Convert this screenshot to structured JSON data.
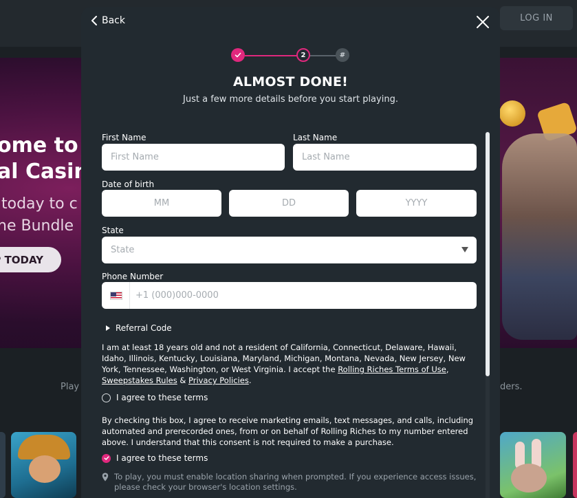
{
  "background": {
    "login_label": "LOG IN",
    "hero_line1": "ome to t",
    "hero_line2": "al Casino",
    "hero_line3": "today to c",
    "hero_line4": "ne Bundle",
    "hero_cta": "P TODAY",
    "sub_left": "Play",
    "sub_right": "ders."
  },
  "modal": {
    "back_label": "Back",
    "steps": [
      {
        "state": "done",
        "label": ""
      },
      {
        "state": "current",
        "label": "2"
      },
      {
        "state": "upcoming",
        "label": "#"
      }
    ],
    "title": "ALMOST DONE!",
    "subtitle": "Just a few more details before you start playing.",
    "form": {
      "first_name": {
        "label": "First Name",
        "placeholder": "First Name",
        "value": ""
      },
      "last_name": {
        "label": "Last Name",
        "placeholder": "Last Name",
        "value": ""
      },
      "dob": {
        "label": "Date of birth",
        "month_placeholder": "MM",
        "day_placeholder": "DD",
        "year_placeholder": "YYYY"
      },
      "state": {
        "label": "State",
        "selected": "State"
      },
      "phone": {
        "label": "Phone Number",
        "placeholder": "+1 (000)000-0000",
        "value": ""
      },
      "referral_label": "Referral Code"
    },
    "terms": {
      "text_before": "I am at least 18 years old and not a resident of California, Connecticut, Delaware, Hawaii, Idaho, Illinois, Kentucky, Louisiana, Maryland, Michigan, Montana, Nevada, New Jersey, New York, Tennessee, Washington, or West Virginia. I accept the ",
      "link_terms": "Rolling Riches Terms of Use",
      "sep1": ", ",
      "link_sweepstakes": "Sweepstakes Rules",
      "sep2": " & ",
      "link_privacy": "Privacy Policies",
      "text_after": ".",
      "agree_label": "I agree to these terms"
    },
    "marketing": {
      "text": "By checking this box, I agree to receive marketing emails, text messages, and calls, including automated and prerecorded ones, from or on behalf of Rolling Riches to my number entered above. I understand that this consent is not required to make a purchase.",
      "agree_label": "I agree to these terms"
    },
    "location_note": "To play, you must enable location sharing when prompted. If you experience access issues, please check your browser's location settings."
  },
  "colors": {
    "accent": "#e0287d",
    "modal_bg": "#222a30",
    "page_bg": "#1b2024"
  },
  "icons": [
    "chevron-left-icon",
    "close-icon",
    "check-icon",
    "caret-down-icon",
    "us-flag-icon",
    "triangle-right-icon",
    "location-pin-icon"
  ]
}
